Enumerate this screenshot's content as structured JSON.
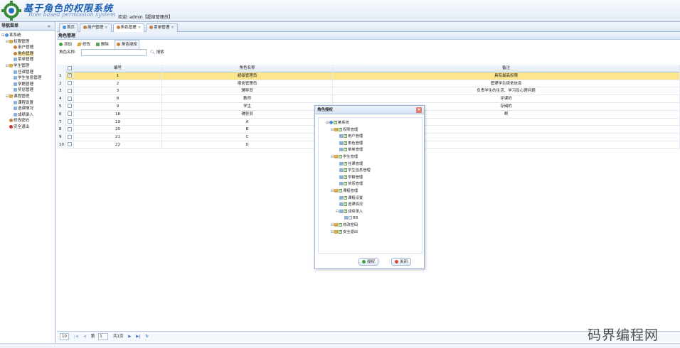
{
  "header": {
    "title_cn": "基于角色的权限系统",
    "title_en": "Role based permission system",
    "welcome": "欢迎: admin【超级管理员】"
  },
  "sidebar": {
    "title": "导航菜单",
    "tree": [
      {
        "label": "某系统",
        "level": 0,
        "icon": "sys-icon"
      },
      {
        "label": "权限管理",
        "level": 1,
        "icon": "folder-icon"
      },
      {
        "label": "用户管理",
        "level": 2,
        "icon": "user-icon"
      },
      {
        "label": "角色管理",
        "level": 2,
        "icon": "user-icon",
        "selected": true
      },
      {
        "label": "菜单管理",
        "level": 2,
        "icon": "page-icon"
      },
      {
        "label": "学生管理",
        "level": 1,
        "icon": "folder-icon"
      },
      {
        "label": "任课管理",
        "level": 2,
        "icon": "page-icon"
      },
      {
        "label": "学生信息管理",
        "level": 2,
        "icon": "page-icon"
      },
      {
        "label": "学籍管理",
        "level": 2,
        "icon": "page-icon"
      },
      {
        "label": "奖惩管理",
        "level": 2,
        "icon": "page-icon"
      },
      {
        "label": "课程管理",
        "level": 1,
        "icon": "folder-icon"
      },
      {
        "label": "课程设置",
        "level": 2,
        "icon": "page-icon"
      },
      {
        "label": "选课情况",
        "level": 2,
        "icon": "page-icon"
      },
      {
        "label": "成绩录入",
        "level": 2,
        "icon": "page-icon"
      },
      {
        "label": "修改密码",
        "level": 1,
        "icon": "user-icon"
      },
      {
        "label": "安全退出",
        "level": 1,
        "icon": "exit-icon"
      }
    ]
  },
  "tabs": [
    {
      "label": "首页",
      "closable": false
    },
    {
      "label": "用户管理",
      "closable": true
    },
    {
      "label": "角色管理",
      "closable": true,
      "active": true
    },
    {
      "label": "菜单管理",
      "closable": true
    }
  ],
  "panel": {
    "title": "角色管理",
    "toolbar": {
      "add": "添加",
      "edit": "修改",
      "delete": "删除",
      "grant": "角色授权"
    },
    "search_label": "角色名称:",
    "search_button": "搜索"
  },
  "grid": {
    "columns": {
      "id": "编号",
      "name": "角色名称",
      "note": "备注"
    },
    "rows": [
      {
        "n": "1",
        "id": "1",
        "name": "超级管理员",
        "note": "具有最高权限",
        "selected": true
      },
      {
        "n": "2",
        "id": "2",
        "name": "宿舍管理员",
        "note": "管理学生宿舍信息"
      },
      {
        "n": "3",
        "id": "3",
        "name": "辅导员",
        "note": "负责学生的生活、学习及心理问题"
      },
      {
        "n": "4",
        "id": "8",
        "name": "教师",
        "note": "评课的"
      },
      {
        "n": "5",
        "id": "9",
        "name": "学生",
        "note": "存储的"
      },
      {
        "n": "6",
        "id": "18",
        "name": "辅导员",
        "note": "啊"
      },
      {
        "n": "7",
        "id": "19",
        "name": "A",
        "note": ""
      },
      {
        "n": "8",
        "id": "20",
        "name": "B",
        "note": ""
      },
      {
        "n": "9",
        "id": "21",
        "name": "C",
        "note": ""
      },
      {
        "n": "10",
        "id": "22",
        "name": "D",
        "note": ""
      }
    ]
  },
  "pager": {
    "page_size": "10",
    "page_label": "第",
    "page_value": "1",
    "total_label": "共1页"
  },
  "dialog": {
    "title": "角色授权",
    "tree": [
      {
        "label": "某系统",
        "level": 0
      },
      {
        "label": "权限管理",
        "level": 1
      },
      {
        "label": "用户管理",
        "level": 2
      },
      {
        "label": "角色管理",
        "level": 2
      },
      {
        "label": "菜单管理",
        "level": 2
      },
      {
        "label": "学生管理",
        "level": 1
      },
      {
        "label": "任课管理",
        "level": 2
      },
      {
        "label": "学生信息管理",
        "level": 2
      },
      {
        "label": "学籍管理",
        "level": 2
      },
      {
        "label": "奖惩管理",
        "level": 2
      },
      {
        "label": "课程管理",
        "level": 1
      },
      {
        "label": "课程设置",
        "level": 2
      },
      {
        "label": "选课情况",
        "level": 2
      },
      {
        "label": "成绩录入",
        "level": 2
      },
      {
        "label": "BB",
        "level": 3,
        "checked": false
      },
      {
        "label": "修改密码",
        "level": 1
      },
      {
        "label": "安全退出",
        "level": 1
      }
    ],
    "ok": "授权",
    "cancel": "关闭"
  },
  "watermark": "码界编程网"
}
